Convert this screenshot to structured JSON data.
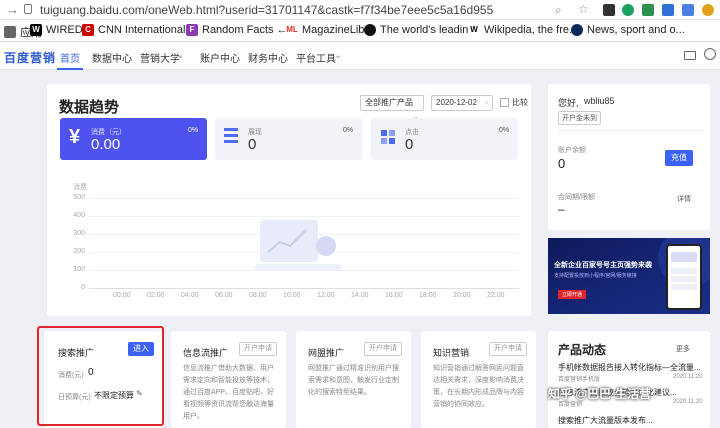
{
  "browser": {
    "url": "tuiguang.baidu.com/oneWeb.html?userid=31701147&castk=f7f34be7eee5c5a16d955",
    "bookmarks": [
      "应用",
      "WIRED",
      "CNN International...",
      "Random Facts ←...",
      "MagazineLib",
      "The world's leadin...",
      "Wikipedia, the fre...",
      "News, sport and o..."
    ]
  },
  "header": {
    "logo": "百度营销",
    "nav": [
      "首页",
      "数据中心",
      "营销大学",
      "账户中心",
      "财务中心",
      "平台工具"
    ]
  },
  "trend": {
    "title": "数据趋势",
    "product_filter": "全部推广产品",
    "date": "2020-12-02",
    "compare_label": "比较",
    "metrics": [
      {
        "label": "消费（元）",
        "value": "0.00",
        "pct": "0%"
      },
      {
        "label": "展现",
        "value": "0",
        "pct": "0%"
      },
      {
        "label": "点击",
        "value": "0",
        "pct": "0%"
      }
    ],
    "chart_ylabel": "消费",
    "y_ticks": [
      "500",
      "400",
      "300",
      "200",
      "100",
      "0"
    ],
    "x_ticks": [
      "00:00",
      "02:00",
      "04:00",
      "06:00",
      "08:00",
      "10:00",
      "12:00",
      "14:00",
      "16:00",
      "18:00",
      "20:00",
      "22:00"
    ]
  },
  "account": {
    "greeting": "您好,",
    "username": "wbliu85",
    "status": "开户金未到",
    "balance_label": "账户余额",
    "balance_value": "0",
    "recharge_label": "充值",
    "contract_label": "合同期/限额",
    "contract_value": "–",
    "detail_label": "详情"
  },
  "banner": {
    "headline": "全新企业百家号号主页强势来袭",
    "sub": "支持配置投放到小程序/官网/服务链接",
    "cta": "立即开通"
  },
  "products": [
    {
      "title": "搜索推广",
      "action": "进入",
      "stats": [
        {
          "label": "消费(元)",
          "value": "0"
        },
        {
          "label": "日预算(元)",
          "value": "不限定预算"
        }
      ]
    },
    {
      "title": "信息流推广",
      "action": "开户申请",
      "desc": "信息流推广借助大数据、用户需求定向和智能投放等技术，通过百度APP、百度贴吧、好看视频等资讯流帮您触达海量用户。"
    },
    {
      "title": "网盟推广",
      "action": "开户申请",
      "desc": "网盟推广通过精准识别用户搜索需求和意图，触发行业定制化的搜索特型结果。"
    },
    {
      "title": "知识营销",
      "action": "开户申请",
      "desc": "知识营销通过解答网民问题直达相关需求，深度影响消费决策，在长期内形成品牌与内容营销的协同效应。"
    }
  ],
  "news": {
    "title": "产品动态",
    "more": "更多",
    "items": [
      {
        "title": "手机帐数据报告接入转化指标—全流量...",
        "meta": "百度营销手机版",
        "date": "2020.11.20"
      },
      {
        "title": "信息流广告投放全链路优化建议...",
        "meta": "百度营销",
        "date": "2020.11.20"
      },
      {
        "title": "搜索推广大流量版本发布...",
        "meta": "",
        "date": ""
      }
    ],
    "watermark": "知乎 @巴巴·生活营"
  },
  "colors": {
    "accent": "#3b62f5",
    "metric_active": "#4e53f0",
    "highlight": "#e0262a"
  }
}
